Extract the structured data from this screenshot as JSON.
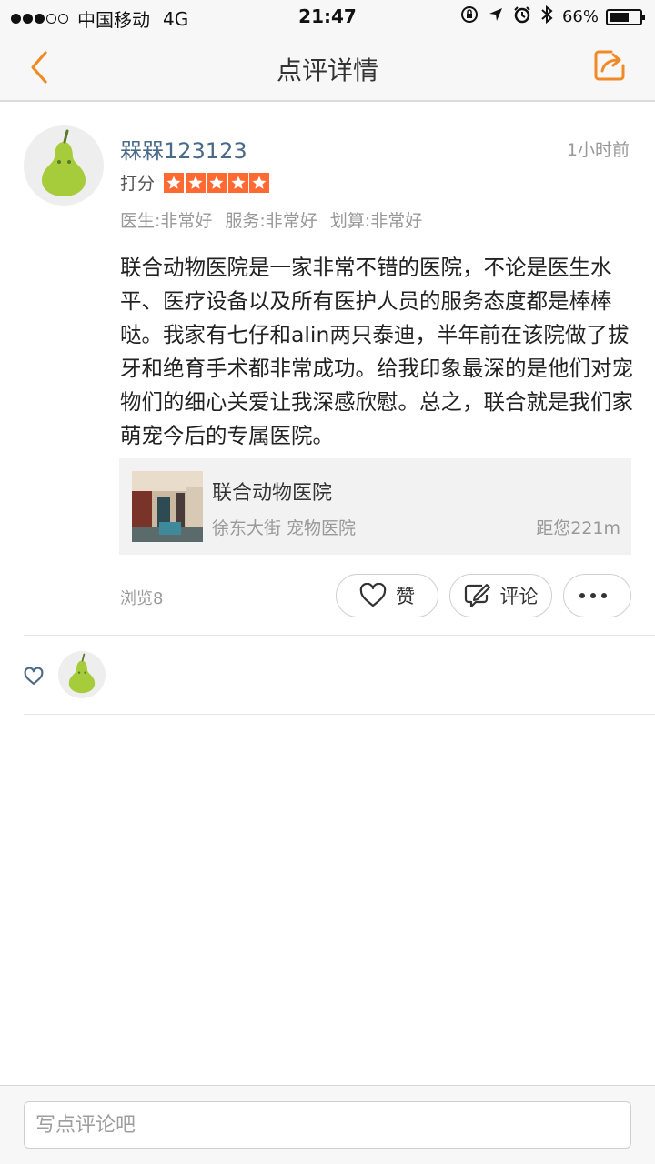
{
  "status_bar": {
    "carrier": "中国移动",
    "network": "4G",
    "time": "21:47",
    "battery": "66%",
    "battery_level": 0.66,
    "signal_bars_filled": 3,
    "signal_bars_total": 5
  },
  "nav": {
    "title": "点评详情",
    "back_icon": "chevron-left-icon",
    "share_icon": "share-icon",
    "accent_color": "#f08a24"
  },
  "review": {
    "username": "槑槑123123",
    "time_ago": "1小时前",
    "rating_label": "打分",
    "rating": 5,
    "rating_max": 5,
    "star_color": "#ff6a33",
    "scores": [
      "医生:非常好",
      "服务:非常好",
      "划算:非常好"
    ],
    "content": "联合动物医院是一家非常不错的医院，不论是医生水平、医疗设备以及所有医护人员的服务态度都是棒棒哒。我家有七仔和alin两只泰迪，半年前在该院做了拔牙和绝育手术都非常成功。给我印象最深的是他们对宠物们的细心关爱让我深感欣慰。总之，联合就是我们家萌宠今后的专属医院。"
  },
  "shop": {
    "name": "联合动物医院",
    "location": "徐东大街 宠物医院",
    "distance": "距您221m"
  },
  "actions": {
    "views": "浏览8",
    "like_label": "赞",
    "comment_label": "评论",
    "more_icon": "more-dots-icon"
  },
  "likers": {
    "icon": "heart-icon"
  },
  "comment_bar": {
    "placeholder": "写点评论吧"
  }
}
